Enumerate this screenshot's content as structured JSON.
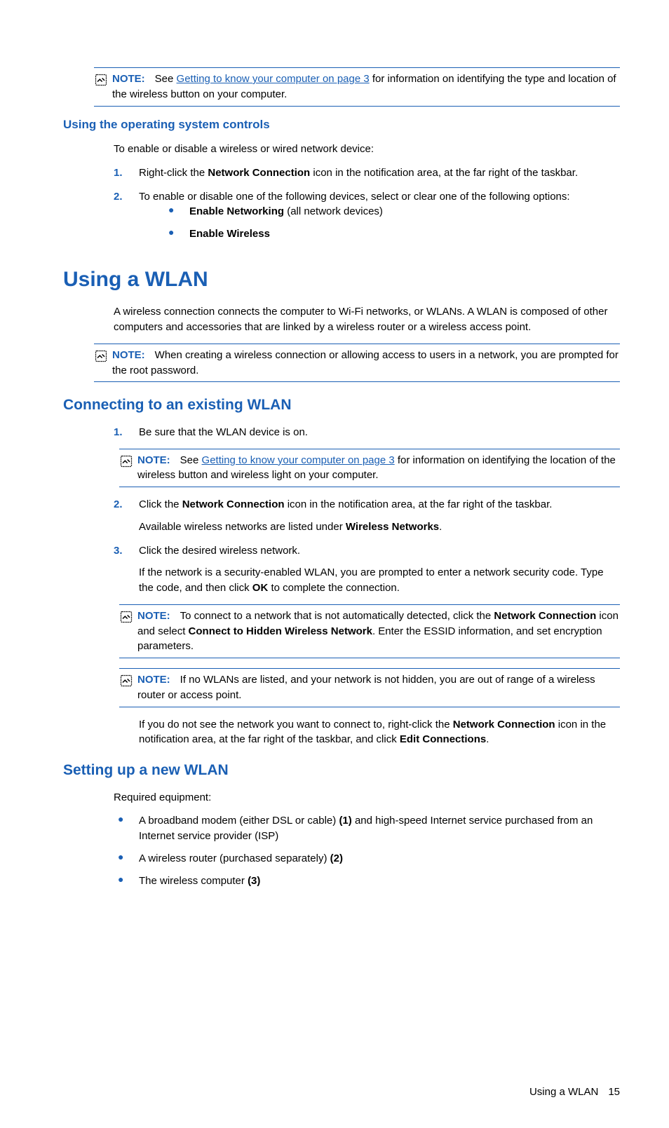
{
  "note1": {
    "label": "NOTE:",
    "pre": "See ",
    "link": "Getting to know your computer on page 3",
    "post": " for information on identifying the type and location of the wireless button on your computer."
  },
  "h_os": "Using the operating system controls",
  "p_os": "To enable or disable a wireless or wired network device:",
  "step1": {
    "num": "1.",
    "pre": "Right-click the ",
    "bold": "Network Connection",
    "post": " icon in the notification area, at the far right of the taskbar."
  },
  "step2": {
    "num": "2.",
    "text": "To enable or disable one of the following devices, select or clear one of the following options:"
  },
  "opt1": {
    "bold": "Enable Networking",
    "post": " (all network devices)"
  },
  "opt2": {
    "bold": "Enable Wireless"
  },
  "h_wlan": "Using a WLAN",
  "p_wlan": "A wireless connection connects the computer to Wi-Fi networks, or WLANs. A WLAN is composed of other computers and accessories that are linked by a wireless router or a wireless access point.",
  "note2": {
    "label": "NOTE:",
    "text": "When creating a wireless connection or allowing access to users in a network, you are prompted for the root password."
  },
  "h_connect": "Connecting to an existing WLAN",
  "cstep1": {
    "num": "1.",
    "text": "Be sure that the WLAN device is on."
  },
  "note3": {
    "label": "NOTE:",
    "pre": "See ",
    "link": "Getting to know your computer on page 3",
    "post": " for information on identifying the location of the wireless button and wireless light on your computer."
  },
  "cstep2": {
    "num": "2.",
    "pre": "Click the ",
    "bold": "Network Connection",
    "post": " icon in the notification area, at the far right of the taskbar.",
    "sub_pre": "Available wireless networks are listed under ",
    "sub_bold": "Wireless Networks",
    "sub_post": "."
  },
  "cstep3": {
    "num": "3.",
    "text": "Click the desired wireless network.",
    "sub_pre": "If the network is a security-enabled WLAN, you are prompted to enter a network security code. Type the code, and then click ",
    "sub_bold": "OK",
    "sub_post": " to complete the connection."
  },
  "note4": {
    "label": "NOTE:",
    "t1": "To connect to a network that is not automatically detected, click the ",
    "b1": "Network Connection",
    "t2": " icon and select ",
    "b2": "Connect to Hidden Wireless Network",
    "t3": ". Enter the ESSID information, and set encryption parameters."
  },
  "note5": {
    "label": "NOTE:",
    "text": "If no WLANs are listed, and your network is not hidden, you are out of range of a wireless router or access point."
  },
  "p_edit": {
    "t1": "If you do not see the network you want to connect to, right-click the ",
    "b1": "Network Connection",
    "t2": " icon in the notification area, at the far right of the taskbar, and click ",
    "b2": "Edit Connections",
    "t3": "."
  },
  "h_setup": "Setting up a new WLAN",
  "p_req": "Required equipment:",
  "eq1": {
    "t1": "A broadband modem (either DSL or cable) ",
    "b1": "(1)",
    "t2": " and high-speed Internet service purchased from an Internet service provider (ISP)"
  },
  "eq2": {
    "t1": "A wireless router (purchased separately) ",
    "b1": "(2)"
  },
  "eq3": {
    "t1": "The wireless computer ",
    "b1": "(3)"
  },
  "footer": {
    "text": "Using a WLAN",
    "page": "15"
  }
}
